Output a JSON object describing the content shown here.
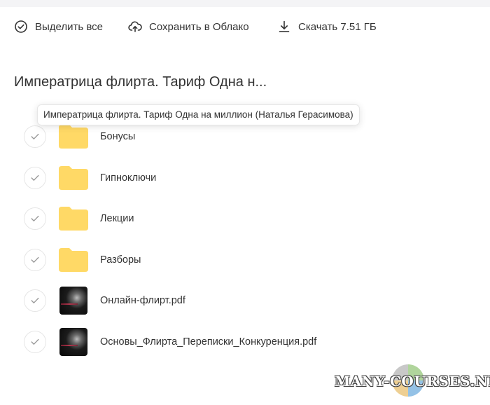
{
  "toolbar": {
    "select_all_label": "Выделить все",
    "save_cloud_label": "Сохранить в Облако",
    "download_label": "Скачать 7.51 ГБ"
  },
  "folder": {
    "title": "Императрица флирта. Тариф Одна н...",
    "tooltip": "Императрица флирта. Тариф Одна на миллион (Наталья Герасимова)"
  },
  "items": [
    {
      "name": "Бонусы",
      "type": "folder-icon"
    },
    {
      "name": "Гипноключи",
      "type": "folder-icon"
    },
    {
      "name": "Лекции",
      "type": "folder-icon"
    },
    {
      "name": "Разборы",
      "type": "folder-icon"
    },
    {
      "name": "Онлайн-флирт.pdf",
      "type": "pdf-thumbnail"
    },
    {
      "name": "Основы_Флирта_Переписки_Конкуренция.pdf",
      "type": "pdf-thumbnail"
    }
  ],
  "watermark": {
    "text": "MANY-COURSES.NET"
  },
  "colors": {
    "folder": "#ffd966",
    "text": "#333333",
    "check_border": "#e6e6e6"
  }
}
